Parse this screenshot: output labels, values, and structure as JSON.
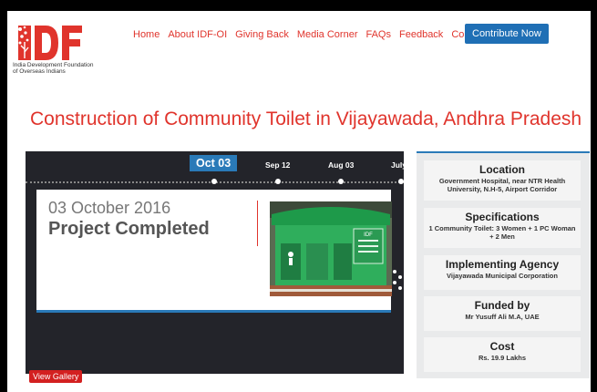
{
  "logo": {
    "mark_text": "IDF",
    "org_line1": "India Development Foundation",
    "org_line2": "of Overseas Indians"
  },
  "nav": {
    "items": [
      "Home",
      "About IDF-OI",
      "Giving Back",
      "Media Corner",
      "FAQs",
      "Feedback",
      "Contact Us"
    ],
    "cta_label": "Contribute Now"
  },
  "colors": {
    "brand_red": "#e0342c",
    "accent_blue": "#2a7ab8",
    "cta_blue": "#1f6fb5"
  },
  "page_title": "Construction of Community Toilet in Vijayawada, Andhra Pradesh",
  "timeline": {
    "dates": [
      "Oct 03",
      "Sep 12",
      "Aug 03",
      "July"
    ],
    "active_date": "Oct 03",
    "event_date": "03 October 2016",
    "event_status": "Project Completed",
    "photo_text": "IDF"
  },
  "gallery_button": "View Gallery",
  "info": [
    {
      "heading": "Location",
      "value": "Government Hospital, near NTR Health University, N.H-5, Airport Corridor"
    },
    {
      "heading": "Specifications",
      "value": "1 Community Toilet: 3 Women + 1 PC Woman + 2 Men"
    },
    {
      "heading": "Implementing Agency",
      "value": "Vijayawada Municipal Corporation"
    },
    {
      "heading": "Funded by",
      "value": "Mr Yusuff Ali M.A, UAE"
    },
    {
      "heading": "Cost",
      "value": "Rs. 19.9 Lakhs"
    }
  ]
}
